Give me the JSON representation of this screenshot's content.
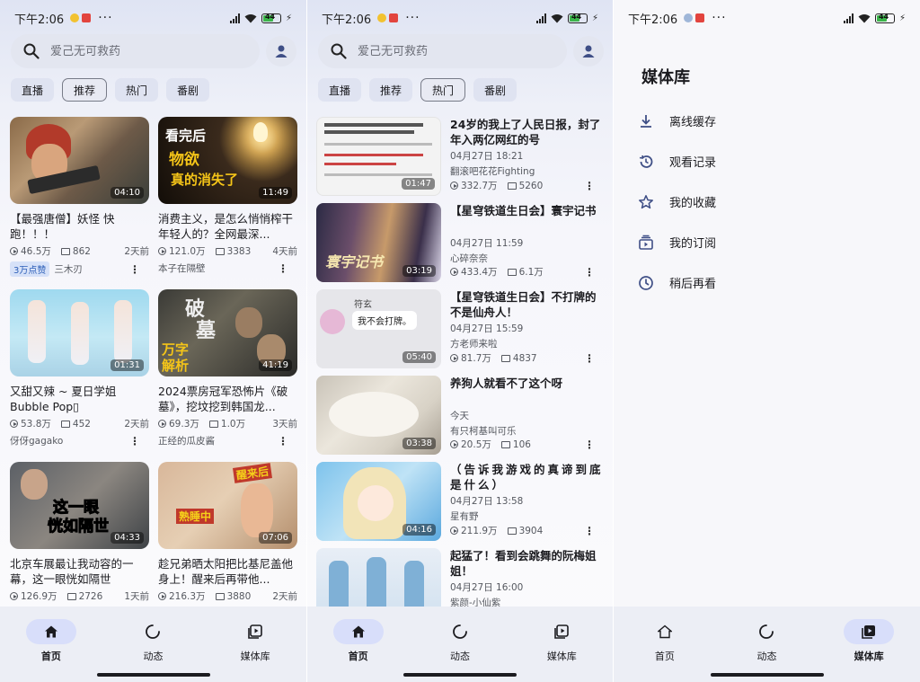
{
  "status": {
    "time": "下午2:06",
    "battery": "44"
  },
  "search": {
    "placeholder": "爱己无可救药"
  },
  "chips": [
    "直播",
    "推荐",
    "热门",
    "番剧"
  ],
  "nav": {
    "home": "首页",
    "dynamic": "动态",
    "library": "媒体库"
  },
  "feed": [
    {
      "title": "【最强唐僧】妖怪 快跑！！！",
      "duration": "04:10",
      "plays": "46.5万",
      "danmaku": "862",
      "ago": "2天前",
      "badge": "3万点赞",
      "uploader": "三木刃"
    },
    {
      "title": "消费主义，是怎么悄悄榨干年轻人的？全网最深...",
      "duration": "11:49",
      "plays": "121.0万",
      "danmaku": "3383",
      "ago": "4天前",
      "badge": "",
      "uploader": "本子在隔壁",
      "thumb_text": [
        "看完后",
        "物欲",
        "真的消失了"
      ]
    },
    {
      "title": "又甜又辣 ~ 夏日学姐 Bubble Pop▯",
      "duration": "01:31",
      "plays": "53.8万",
      "danmaku": "452",
      "ago": "2天前",
      "badge": "",
      "uploader": "伢伢gagako"
    },
    {
      "title": "2024票房冠军恐怖片《破墓》，挖坟挖到韩国龙...",
      "duration": "41:19",
      "plays": "69.3万",
      "danmaku": "1.0万",
      "ago": "3天前",
      "badge": "",
      "uploader": "正经的瓜皮酱",
      "thumb_text": [
        "破",
        "墓",
        "万字",
        "解析"
      ]
    },
    {
      "title": "北京车展最让我动容的一幕，这一眼恍如隔世",
      "duration": "04:33",
      "plays": "126.9万",
      "danmaku": "2726",
      "ago": "1天前",
      "badge": "",
      "uploader": "",
      "thumb_text": [
        "这一眼",
        "恍如隔世"
      ]
    },
    {
      "title": "趁兄弟晒太阳把比基尼盖他身上！醒来后再带他...",
      "duration": "07:06",
      "plays": "216.3万",
      "danmaku": "3880",
      "ago": "2天前",
      "badge": "",
      "uploader": "",
      "thumb_text": [
        "醒来后",
        "熟睡中"
      ]
    }
  ],
  "hot": [
    {
      "title": "24岁的我上了人民日报，封了年入两亿网红的号",
      "date": "04月27日 18:21",
      "uploader": "翻滚吧花花Fighting",
      "duration": "01:47",
      "plays": "332.7万",
      "danmaku": "5260"
    },
    {
      "title": "【星穹铁道生日会】寰宇记书",
      "date": "04月27日 11:59",
      "uploader": "心碎奈奈",
      "duration": "03:19",
      "plays": "433.4万",
      "danmaku": "6.1万",
      "thumb_text": "寰宇记书"
    },
    {
      "title": "【星穹铁道生日会】不打牌的不是仙舟人！",
      "date": "04月27日 15:59",
      "uploader": "方老师来啦",
      "duration": "05:40",
      "plays": "81.7万",
      "danmaku": "4837",
      "thumb_text": [
        "符玄",
        "我不会打牌。"
      ]
    },
    {
      "title": "养狗人就看不了这个呀",
      "date": "今天",
      "uploader": "有只柯基叫可乐",
      "duration": "03:38",
      "plays": "20.5万",
      "danmaku": "106"
    },
    {
      "title": "（告诉我游戏的真谛到底是什么）",
      "date": "04月27日 13:58",
      "uploader": "星有野",
      "duration": "04:16",
      "plays": "211.9万",
      "danmaku": "3904"
    },
    {
      "title": "起猛了！看到会跳舞的阮梅姐姐！",
      "date": "04月27日 16:00",
      "uploader": "紫颜-小仙紫",
      "duration": "",
      "plays": "",
      "danmaku": ""
    }
  ],
  "library": {
    "title": "媒体库",
    "items": [
      "离线缓存",
      "观看记录",
      "我的收藏",
      "我的订阅",
      "稍后再看"
    ]
  }
}
